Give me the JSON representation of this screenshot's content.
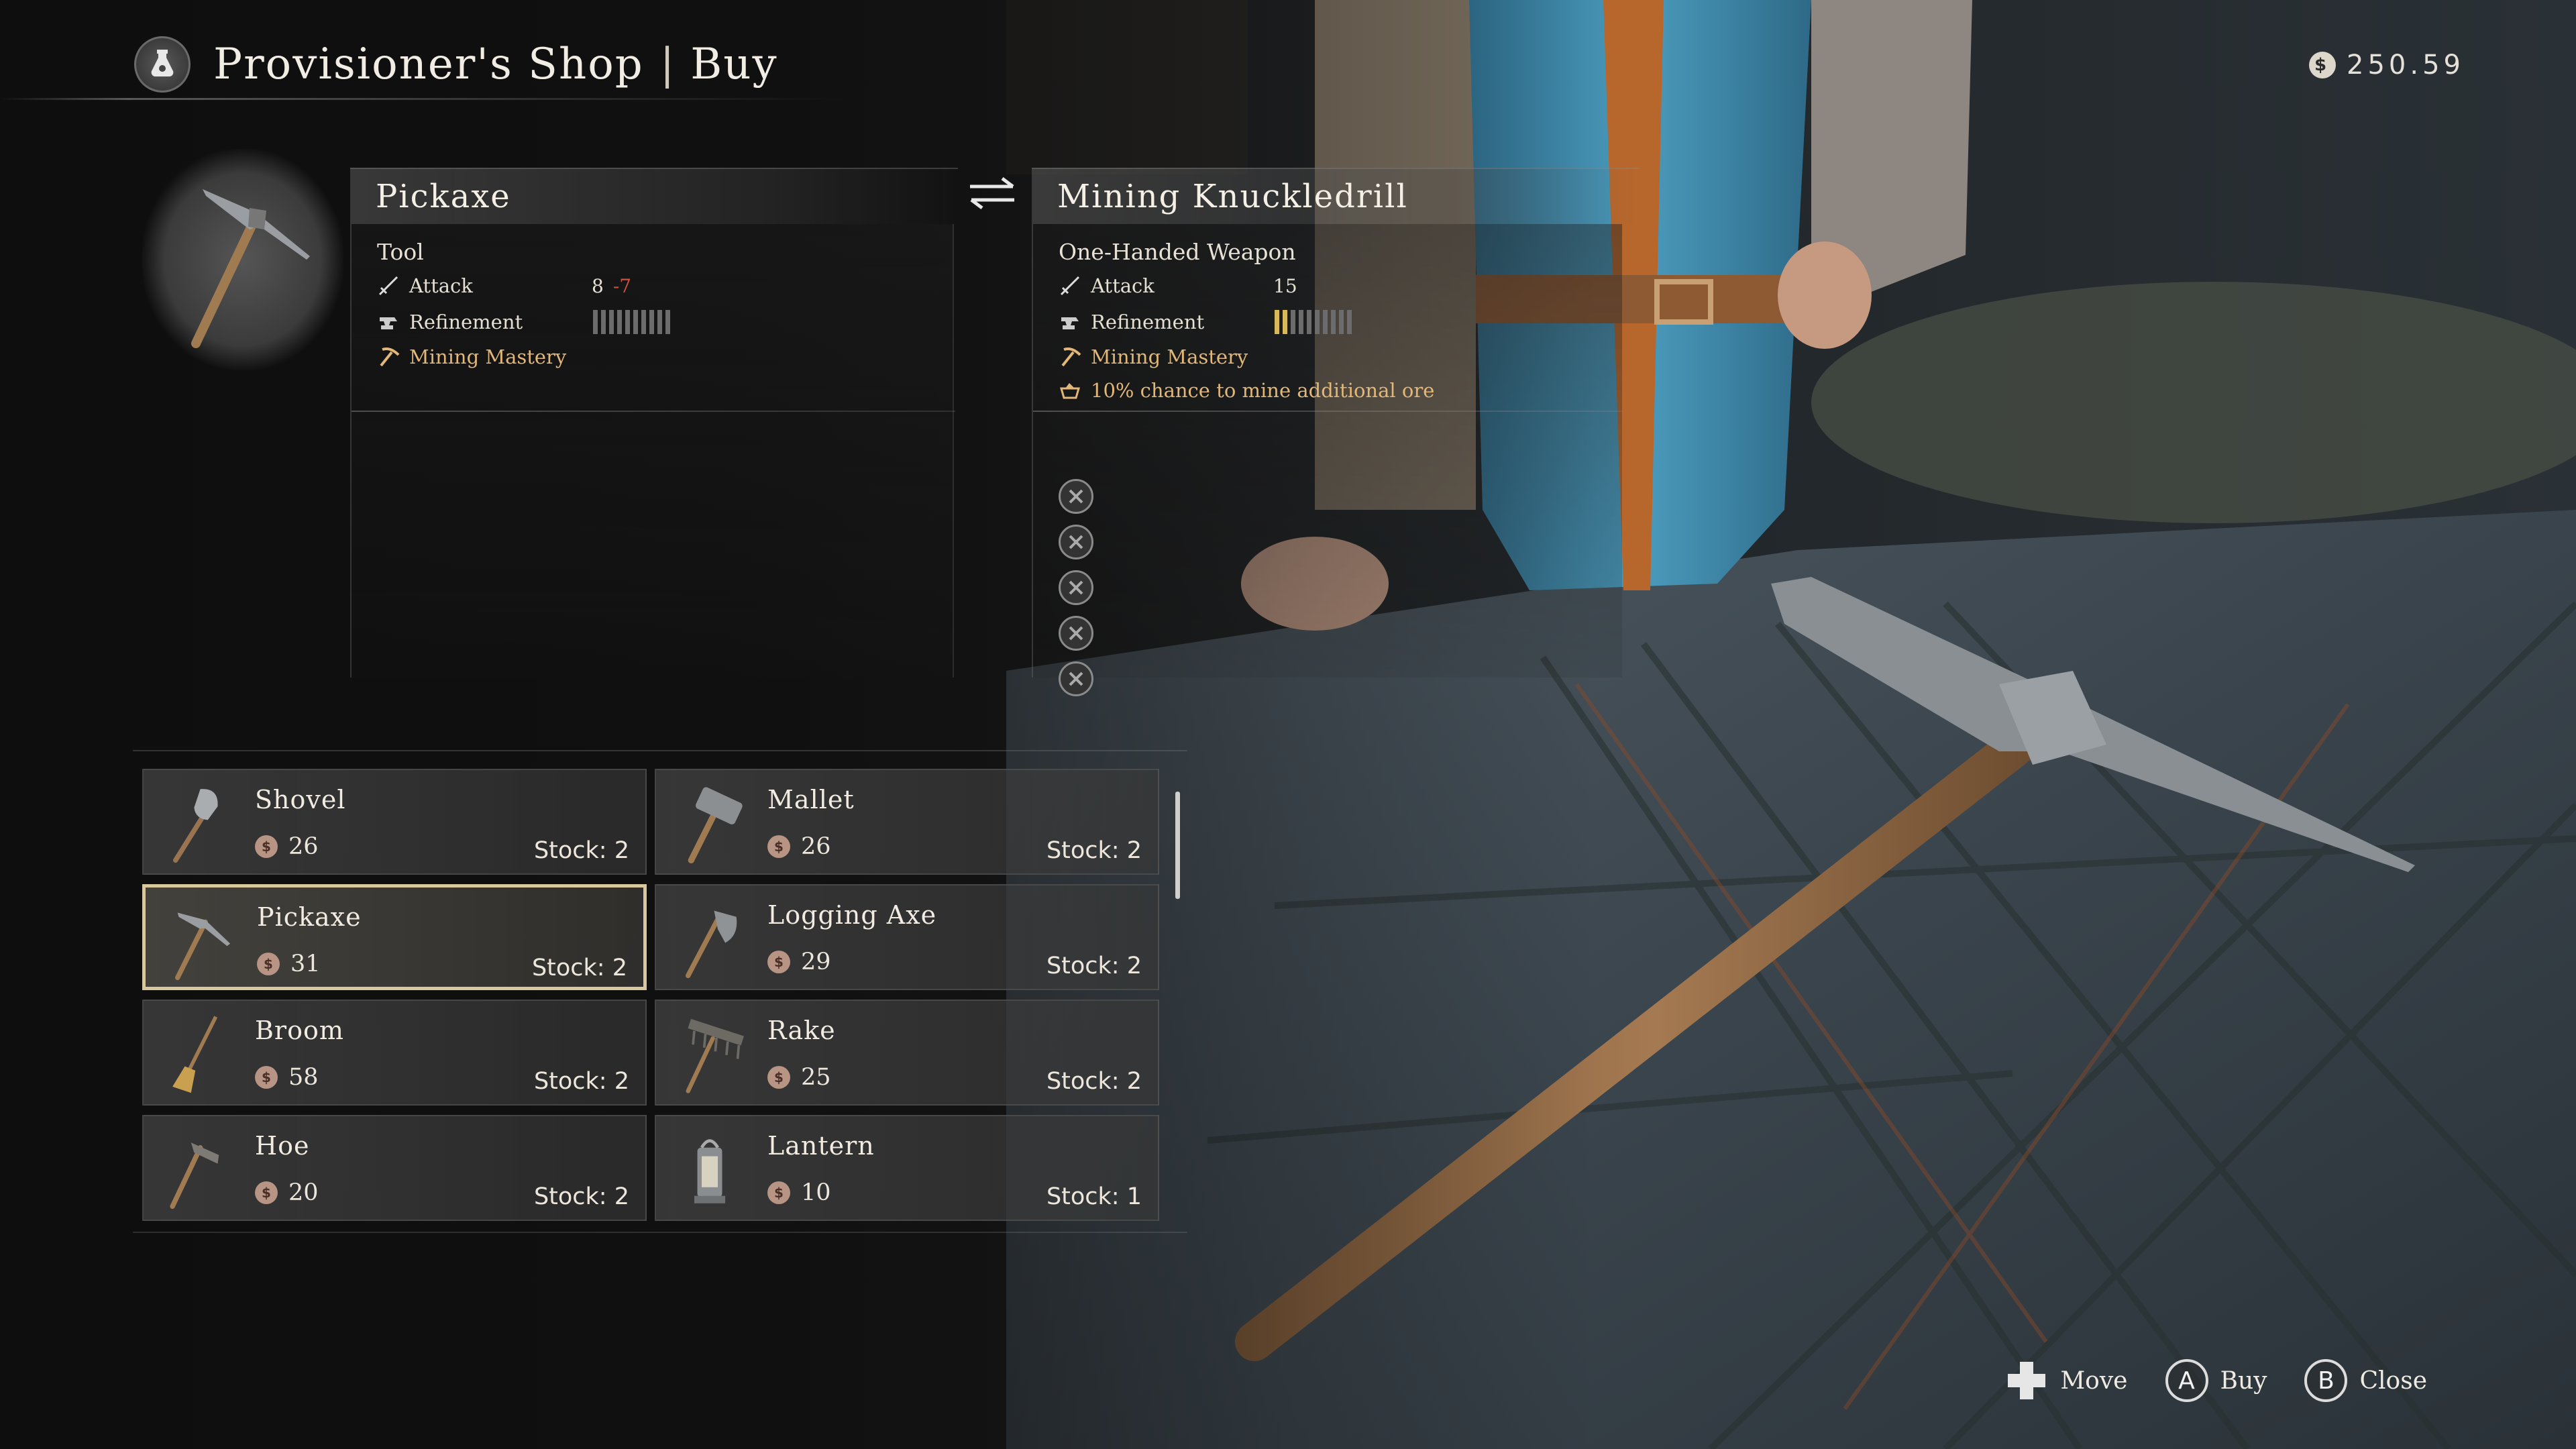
{
  "header": {
    "title": "Provisioner's Shop",
    "separator": "|",
    "mode": "Buy",
    "icon": "potion-bag-icon"
  },
  "currency": {
    "amount": "250.59",
    "icon": "coin-icon"
  },
  "current_item": {
    "name": "Pickaxe",
    "type": "Tool",
    "attack_label": "Attack",
    "attack_value": "8",
    "attack_delta": "-7",
    "refinement_label": "Refinement",
    "refinement_level": 0,
    "refinement_max": 10,
    "mastery": "Mining Mastery"
  },
  "compare_item": {
    "name": "Mining Knuckledrill",
    "type": "One-Handed Weapon",
    "attack_label": "Attack",
    "attack_value": "15",
    "refinement_label": "Refinement",
    "refinement_level": 2,
    "refinement_max": 10,
    "mastery": "Mining Mastery",
    "perk": "10% chance to mine additional ore",
    "empty_slots": 5
  },
  "shop_items": [
    {
      "name": "Shovel",
      "price": "26",
      "stock": "Stock: 2",
      "icon": "shovel-icon",
      "selected": false
    },
    {
      "name": "Mallet",
      "price": "26",
      "stock": "Stock: 2",
      "icon": "mallet-icon",
      "selected": false
    },
    {
      "name": "Pickaxe",
      "price": "31",
      "stock": "Stock: 2",
      "icon": "pickaxe-icon",
      "selected": true
    },
    {
      "name": "Logging Axe",
      "price": "29",
      "stock": "Stock: 2",
      "icon": "axe-icon",
      "selected": false
    },
    {
      "name": "Broom",
      "price": "58",
      "stock": "Stock: 2",
      "icon": "broom-icon",
      "selected": false
    },
    {
      "name": "Rake",
      "price": "25",
      "stock": "Stock: 2",
      "icon": "rake-icon",
      "selected": false
    },
    {
      "name": "Hoe",
      "price": "20",
      "stock": "Stock: 2",
      "icon": "hoe-icon",
      "selected": false
    },
    {
      "name": "Lantern",
      "price": "10",
      "stock": "Stock: 1",
      "icon": "lantern-icon",
      "selected": false
    }
  ],
  "footer": {
    "move_label": "Move",
    "buy_button": "A",
    "buy_label": "Buy",
    "close_button": "B",
    "close_label": "Close"
  },
  "colors": {
    "accent": "#d9c89e",
    "mastery": "#e3b778",
    "negative": "#d0503c",
    "refined": "#d9b85a"
  }
}
